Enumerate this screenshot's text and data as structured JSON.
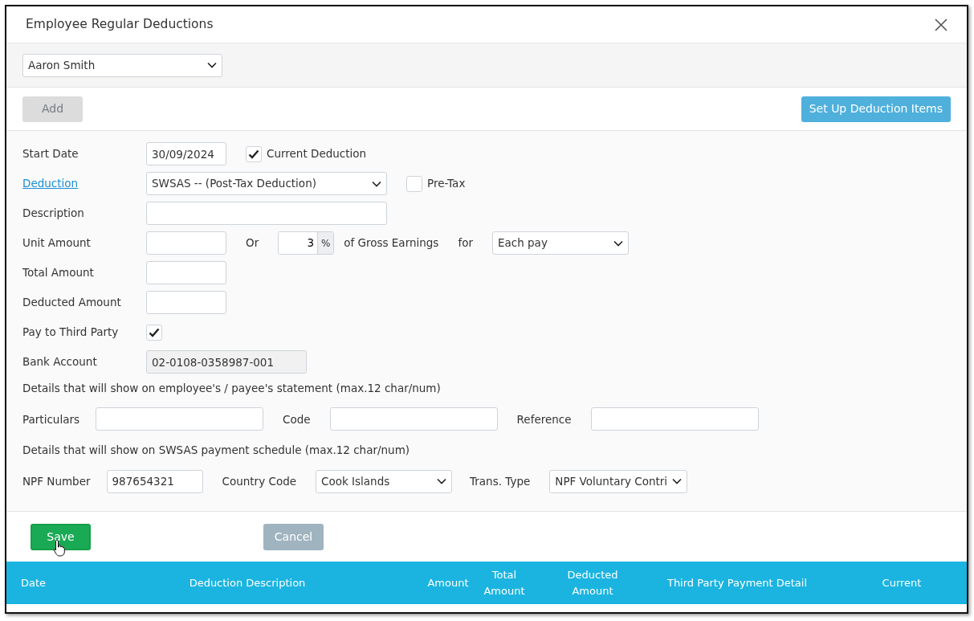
{
  "window": {
    "title": "Employee Regular Deductions"
  },
  "employee_select": {
    "value": "Aaron Smith"
  },
  "toolbar": {
    "add_button": {
      "label": "Add",
      "disabled": true
    },
    "setup_button": {
      "label": "Set Up Deduction Items"
    }
  },
  "form": {
    "start_date": {
      "label": "Start Date",
      "value": "30/09/2024"
    },
    "current_deduction": {
      "label": "Current Deduction",
      "checked": true
    },
    "deduction": {
      "label": "Deduction",
      "value": "SWSAS -- (Post-Tax Deduction)"
    },
    "pre_tax": {
      "label": "Pre-Tax",
      "checked": false
    },
    "description": {
      "label": "Description"
    },
    "unit_amount": {
      "label": "Unit Amount"
    },
    "or_text": "Or",
    "percent": {
      "value": "3",
      "unit": "%"
    },
    "gross_text": "of Gross Earnings",
    "for_text": "for",
    "frequency": {
      "value": "Each pay"
    },
    "total_amount": {
      "label": "Total Amount"
    },
    "deducted_amount": {
      "label": "Deducted Amount"
    },
    "pay_third_party": {
      "label": "Pay to Third Party",
      "checked": true
    },
    "bank_account": {
      "label": "Bank Account",
      "value": "02-0108-0358987-001",
      "disabled": true
    },
    "statement_note": "Details that will show on employee's / payee's statement (max.12 char/num)",
    "particulars": {
      "label": "Particulars"
    },
    "code": {
      "label": "Code"
    },
    "reference": {
      "label": "Reference"
    },
    "schedule_note": "Details that will show on SWSAS payment schedule (max.12 char/num)",
    "npf_number": {
      "label": "NPF Number",
      "value": "987654321"
    },
    "country_code": {
      "label": "Country Code",
      "value": "Cook Islands"
    },
    "trans_type": {
      "label": "Trans. Type",
      "value": "NPF Voluntary Contri"
    }
  },
  "footer": {
    "save_button": "Save",
    "cancel_button": "Cancel"
  },
  "table": {
    "columns": [
      "Date",
      "Deduction Description",
      "Amount",
      "Total Amount",
      "Deducted Amount",
      "Third Party Payment Detail",
      "Current"
    ]
  }
}
